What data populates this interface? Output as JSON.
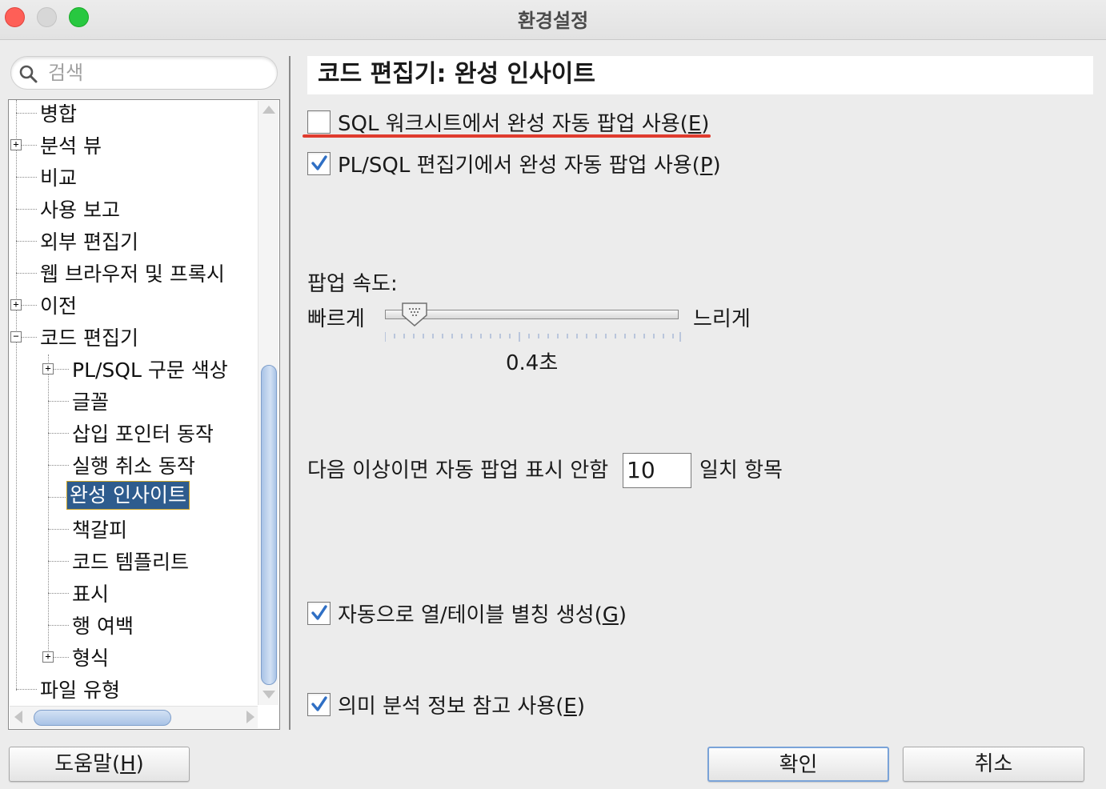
{
  "window": {
    "title": "환경설정"
  },
  "search": {
    "placeholder": "검색"
  },
  "tree": {
    "items": [
      {
        "label": "병합"
      },
      {
        "label": "분석 뷰"
      },
      {
        "label": "비교"
      },
      {
        "label": "사용 보고"
      },
      {
        "label": "외부 편집기"
      },
      {
        "label": "웹 브라우저 및 프록시"
      },
      {
        "label": "이전"
      },
      {
        "label": "코드 편집기"
      },
      {
        "label": "PL/SQL 구문 색상"
      },
      {
        "label": "글꼴"
      },
      {
        "label": "삽입 포인터 동작"
      },
      {
        "label": "실행 취소 동작"
      },
      {
        "label": "완성 인사이트"
      },
      {
        "label": "책갈피"
      },
      {
        "label": "코드 템플리트"
      },
      {
        "label": "표시"
      },
      {
        "label": "행 여백"
      },
      {
        "label": "형식"
      },
      {
        "label": "파일 유형"
      }
    ],
    "selected": "완성 인사이트"
  },
  "panel": {
    "title": "코드 편집기: 완성 인사이트",
    "sql_worksheet": {
      "label": "SQL 워크시트에서 완성 자동 팝업 사용(",
      "key": "E",
      "suffix": ")",
      "checked": false
    },
    "plsql_editor": {
      "label": "PL/SQL 편집기에서 완성 자동 팝업 사용(",
      "key": "P",
      "suffix": ")",
      "checked": true
    },
    "popup_speed": {
      "label": "팝업 속도:",
      "fast": "빠르게",
      "slow": "느리게",
      "value_text": "0.4초",
      "position_fraction": 0.1
    },
    "threshold": {
      "prefix": "다음 이상이면 자동 팝업 표시 안함",
      "value": "10",
      "suffix": "일치 항목"
    },
    "alias": {
      "label": "자동으로 열/테이블 별칭 생성(",
      "key": "G",
      "suffix": ")",
      "checked": true
    },
    "semantic": {
      "label": "의미 분석 정보 참고 사용(",
      "key": "E",
      "suffix": ")",
      "checked": true
    }
  },
  "buttons": {
    "help": {
      "label": "도움말(",
      "key": "H",
      "suffix": ")"
    },
    "ok": "확인",
    "cancel": "취소"
  },
  "colors": {
    "selection": "#2e5c8e",
    "annotation": "#e03b2e",
    "check": "#2f6fc4"
  }
}
